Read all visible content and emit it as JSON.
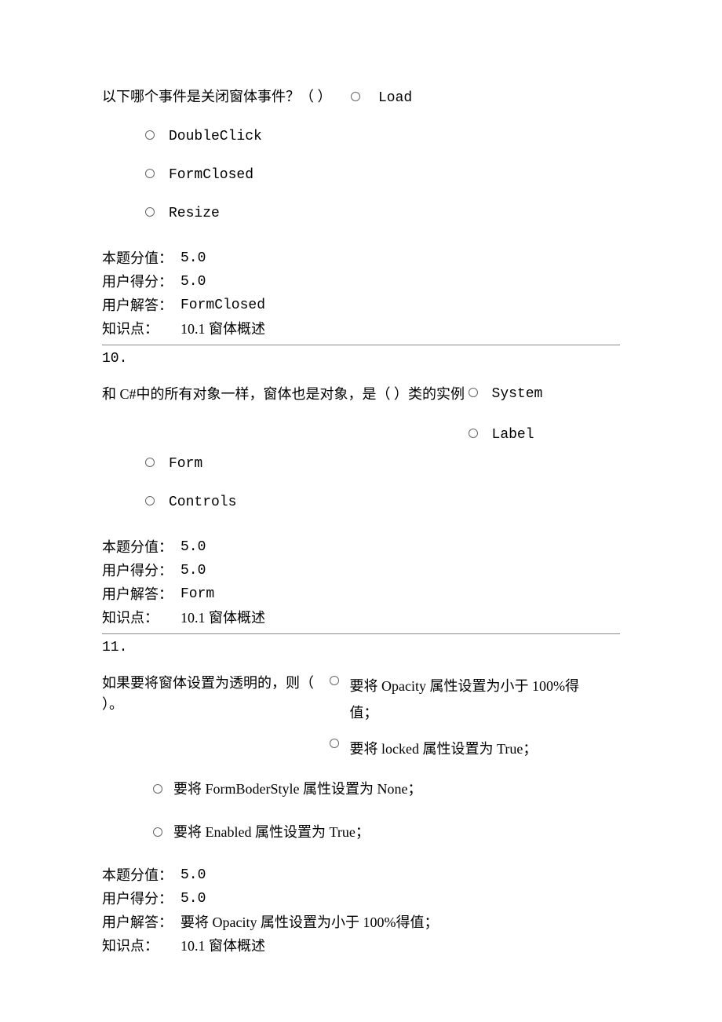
{
  "q9": {
    "text": "以下哪个事件是关闭窗体事件？（ ）",
    "options": [
      "Load",
      "DoubleClick",
      "FormClosed",
      "Resize"
    ],
    "score_label": "本题分值：",
    "score_value": "5.0",
    "user_score_label": "用户得分：",
    "user_score_value": "5.0",
    "user_answer_label": "用户解答：",
    "user_answer_value": "FormClosed",
    "kp_label": "知识点：",
    "kp_value": "10.1 窗体概述"
  },
  "q10": {
    "number": "10.",
    "text": "和 C#中的所有对象一样，窗体也是对象，是（ ）类的实例",
    "options": [
      "System",
      "Label",
      "Form",
      "Controls"
    ],
    "score_label": "本题分值：",
    "score_value": "5.0",
    "user_score_label": "用户得分：",
    "user_score_value": "5.0",
    "user_answer_label": "用户解答：",
    "user_answer_value": "Form",
    "kp_label": "知识点：",
    "kp_value": "10.1 窗体概述"
  },
  "q11": {
    "number": "11.",
    "text": "如果要将窗体设置为透明的，则（ ）。",
    "options": [
      "要将 Opacity 属性设置为小于 100%得值；",
      "要将 locked 属性设置为 True；",
      "要将 FormBoderStyle 属性设置为 None；",
      "要将 Enabled 属性设置为 True；"
    ],
    "score_label": "本题分值：",
    "score_value": "5.0",
    "user_score_label": "用户得分：",
    "user_score_value": "5.0",
    "user_answer_label": "用户解答：",
    "user_answer_value": "要将 Opacity 属性设置为小于 100%得值；",
    "kp_label": "知识点：",
    "kp_value": "10.1 窗体概述"
  }
}
